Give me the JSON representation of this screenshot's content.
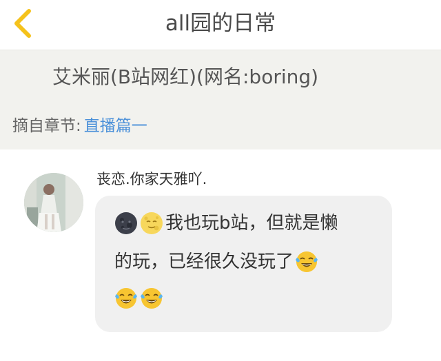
{
  "header": {
    "title": "all园的日常"
  },
  "quote": {
    "text": "艾米丽(B站网红)(网名:boring)",
    "source_label": "摘自章节:",
    "source_chapter": "直播篇一"
  },
  "comment": {
    "username": "丧恋.你家天雅吖.",
    "message": {
      "line1_text": "我也玩b站，但就是懒",
      "line2_text": "的玩，已经很久没玩了"
    },
    "emojis": [
      "new-moon-face",
      "full-moon-face",
      "face-with-tears-of-joy"
    ]
  },
  "colors": {
    "accent_yellow": "#f5c21b",
    "link_blue": "#4a90d9",
    "panel_bg": "#f2f2ee",
    "bubble_bg": "#f0f0f0"
  }
}
